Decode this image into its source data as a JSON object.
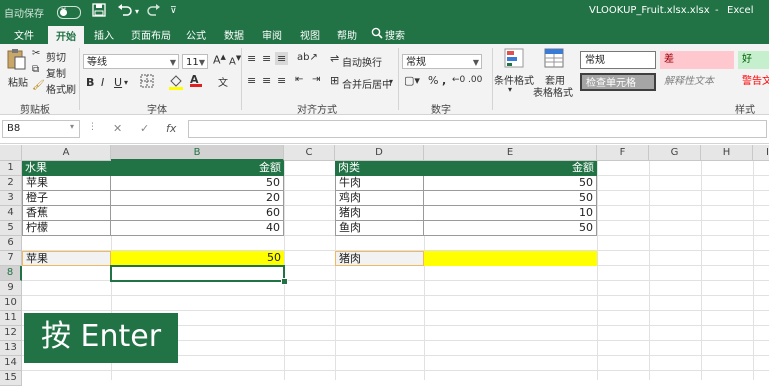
{
  "titlebar": {
    "autosave_label": "自动保存",
    "toggle_state": "关",
    "filename": "VLOOKUP_Fruit.xlsx.xlsx",
    "separator": "-",
    "app_name": "Excel"
  },
  "tabs": [
    "文件",
    "开始",
    "插入",
    "页面布局",
    "公式",
    "数据",
    "审阅",
    "视图",
    "帮助"
  ],
  "active_tab": "开始",
  "search_label": "搜索",
  "ribbon": {
    "clipboard": {
      "paste": "粘贴",
      "cut": "剪切",
      "copy": "复制",
      "format_painter": "格式刷",
      "group": "剪贴板"
    },
    "font": {
      "name": "等线",
      "size": "11",
      "group": "字体"
    },
    "alignment": {
      "wrap": "自动换行",
      "merge": "合并后居中",
      "group": "对齐方式"
    },
    "number": {
      "format": "常规",
      "group": "数字"
    },
    "styles": {
      "conditional": "条件格式",
      "table_format_1": "套用",
      "table_format_2": "表格格式",
      "normal": "常规",
      "bad": "差",
      "good": "好",
      "check_cell": "检查单元格",
      "explanatory": "解释性文本",
      "warning": "警告文",
      "group": "样式"
    }
  },
  "formula_bar": {
    "name_box": "B8",
    "fx": "fx",
    "value": ""
  },
  "columns": [
    "A",
    "B",
    "C",
    "D",
    "E",
    "F",
    "G",
    "H",
    "I"
  ],
  "selected_column": "B",
  "rows": [
    "1",
    "2",
    "3",
    "4",
    "5",
    "6",
    "7",
    "8",
    "9",
    "10",
    "11",
    "12",
    "13",
    "14",
    "15"
  ],
  "selected_row": "8",
  "fruit_table": {
    "header": [
      "水果",
      "金额"
    ],
    "rows": [
      [
        "苹果",
        "50"
      ],
      [
        "橙子",
        "20"
      ],
      [
        "香蕉",
        "60"
      ],
      [
        "柠檬",
        "40"
      ]
    ]
  },
  "meat_table": {
    "header": [
      "肉类",
      "金额"
    ],
    "rows": [
      [
        "牛肉",
        "50"
      ],
      [
        "鸡肉",
        "50"
      ],
      [
        "猪肉",
        "10"
      ],
      [
        "鱼肉",
        "50"
      ]
    ]
  },
  "lookup_1": {
    "key": "苹果",
    "result": "50"
  },
  "lookup_2": {
    "key": "猪肉",
    "result": ""
  },
  "overlay_text": "按 Enter",
  "colors": {
    "excel_green": "#217346",
    "highlight_yellow": "#ffff00",
    "lookup_border": "#f0b860"
  }
}
